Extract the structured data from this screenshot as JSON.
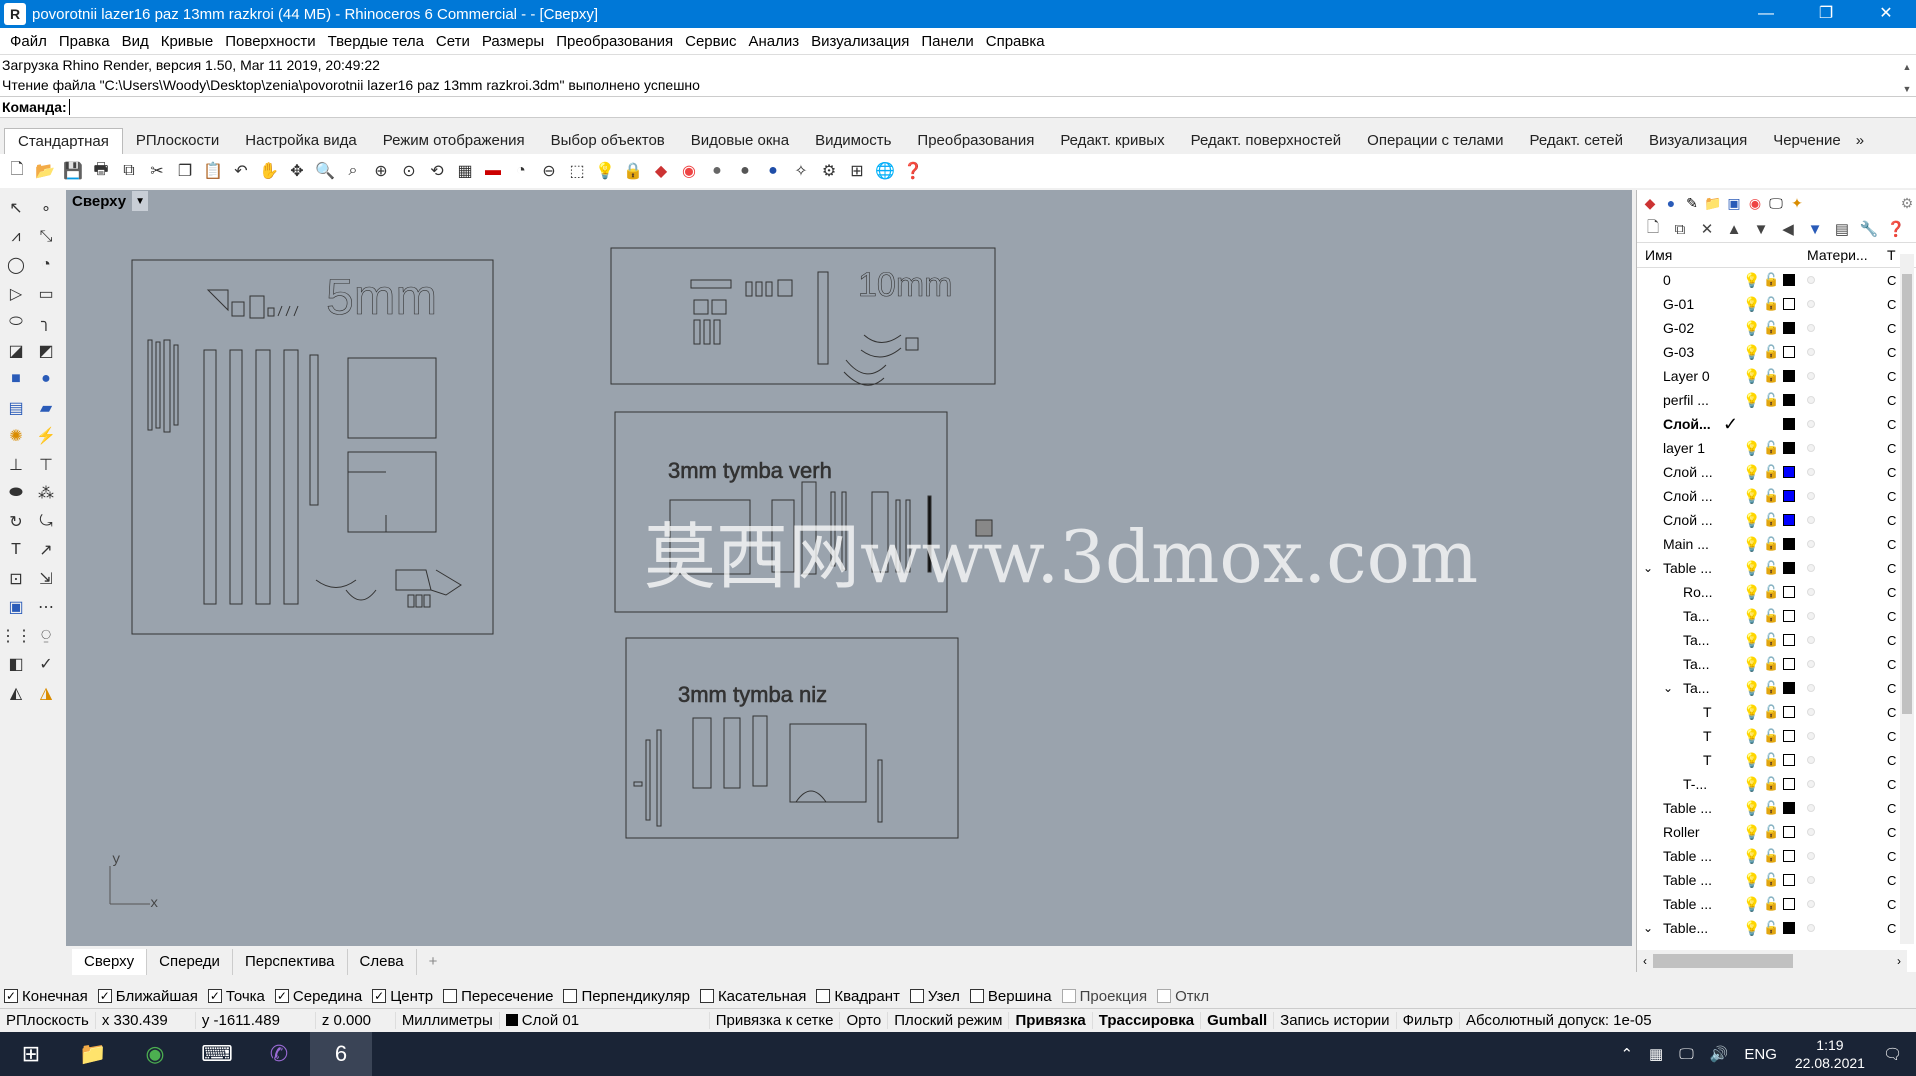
{
  "window": {
    "title": "povorotnii lazer16 paz 13mm razkroi (44 МБ) - Rhinoceros 6 Commercial - - [Сверху]",
    "minimize": "—",
    "maximize": "❐",
    "close": "✕"
  },
  "menu": [
    "Файл",
    "Правка",
    "Вид",
    "Кривые",
    "Поверхности",
    "Твердые тела",
    "Сети",
    "Размеры",
    "Преобразования",
    "Сервис",
    "Анализ",
    "Визуализация",
    "Панели",
    "Справка"
  ],
  "history": [
    "Загрузка Rhino Render, версия 1.50, Mar 11 2019, 20:49:22",
    "Чтение файла \"C:\\Users\\Woody\\Desktop\\zenia\\povorotnii lazer16 paz 13mm razkroi.3dm\" выполнено успешно"
  ],
  "command": {
    "label": "Команда:",
    "value": ""
  },
  "toolbar_tabs": [
    "Стандартная",
    "РПлоскости",
    "Настройка вида",
    "Режим отображения",
    "Выбор объектов",
    "Видовые окна",
    "Видимость",
    "Преобразования",
    "Редакт. кривых",
    "Редакт. поверхностей",
    "Операции с телами",
    "Редакт. сетей",
    "Визуализация",
    "Черчение"
  ],
  "viewport": {
    "name": "Сверху",
    "axis_x": "x",
    "axis_y": "y",
    "panels": [
      {
        "label": "5mm"
      },
      {
        "label": "10mm"
      },
      {
        "label": "3mm tymba verh"
      },
      {
        "label": "3mm tymba niz"
      }
    ],
    "watermark": "莫西网www.3dmox.com"
  },
  "viewport_tabs": [
    "Сверху",
    "Спереди",
    "Перспектива",
    "Слева"
  ],
  "layers": {
    "col_name": "Имя",
    "col_material": "Матери...",
    "col_t": "Т",
    "rows": [
      {
        "name": "0",
        "indent": 0,
        "color": "#000000",
        "current": false,
        "expander": ""
      },
      {
        "name": "G-01",
        "indent": 0,
        "color": "#ffffff",
        "current": false,
        "expander": ""
      },
      {
        "name": "G-02",
        "indent": 0,
        "color": "#000000",
        "current": false,
        "expander": ""
      },
      {
        "name": "G-03",
        "indent": 0,
        "color": "#ffffff",
        "current": false,
        "expander": ""
      },
      {
        "name": "Layer 0",
        "indent": 0,
        "color": "#000000",
        "current": false,
        "expander": ""
      },
      {
        "name": "perfil ...",
        "indent": 0,
        "color": "#000000",
        "current": false,
        "expander": ""
      },
      {
        "name": "Слой...",
        "indent": 0,
        "color": "#000000",
        "current": true,
        "expander": ""
      },
      {
        "name": "layer 1",
        "indent": 0,
        "color": "#000000",
        "current": false,
        "expander": ""
      },
      {
        "name": "Слой ...",
        "indent": 0,
        "color": "#0000ff",
        "current": false,
        "expander": ""
      },
      {
        "name": "Слой ...",
        "indent": 0,
        "color": "#0000ff",
        "current": false,
        "expander": ""
      },
      {
        "name": "Слой ...",
        "indent": 0,
        "color": "#0000ff",
        "current": false,
        "expander": ""
      },
      {
        "name": "Main ...",
        "indent": 0,
        "color": "#000000",
        "current": false,
        "expander": ""
      },
      {
        "name": "Table ...",
        "indent": 0,
        "color": "#000000",
        "current": false,
        "expander": "⌄"
      },
      {
        "name": "Ro...",
        "indent": 1,
        "color": "#ffffff",
        "current": false,
        "expander": ""
      },
      {
        "name": "Ta...",
        "indent": 1,
        "color": "#ffffff",
        "current": false,
        "expander": ""
      },
      {
        "name": "Ta...",
        "indent": 1,
        "color": "#ffffff",
        "current": false,
        "expander": ""
      },
      {
        "name": "Ta...",
        "indent": 1,
        "color": "#ffffff",
        "current": false,
        "expander": ""
      },
      {
        "name": "Ta...",
        "indent": 1,
        "color": "#000000",
        "current": false,
        "expander": "⌄"
      },
      {
        "name": "T",
        "indent": 2,
        "color": "#ffffff",
        "current": false,
        "expander": ""
      },
      {
        "name": "T",
        "indent": 2,
        "color": "#ffffff",
        "current": false,
        "expander": ""
      },
      {
        "name": "T",
        "indent": 2,
        "color": "#ffffff",
        "current": false,
        "expander": ""
      },
      {
        "name": "T-...",
        "indent": 1,
        "color": "#ffffff",
        "current": false,
        "expander": ""
      },
      {
        "name": "Table ...",
        "indent": 0,
        "color": "#000000",
        "current": false,
        "expander": ""
      },
      {
        "name": "Roller",
        "indent": 0,
        "color": "#ffffff",
        "current": false,
        "expander": ""
      },
      {
        "name": "Table ...",
        "indent": 0,
        "color": "#ffffff",
        "current": false,
        "expander": ""
      },
      {
        "name": "Table ...",
        "indent": 0,
        "color": "#ffffff",
        "current": false,
        "expander": ""
      },
      {
        "name": "Table ...",
        "indent": 0,
        "color": "#ffffff",
        "current": false,
        "expander": ""
      },
      {
        "name": "Table...",
        "indent": 0,
        "color": "#000000",
        "current": false,
        "expander": "⌄"
      }
    ],
    "t_value": "С"
  },
  "osnaps": [
    {
      "label": "Конечная",
      "checked": true,
      "enabled": true
    },
    {
      "label": "Ближайшая",
      "checked": true,
      "enabled": true
    },
    {
      "label": "Точка",
      "checked": true,
      "enabled": true
    },
    {
      "label": "Середина",
      "checked": true,
      "enabled": true
    },
    {
      "label": "Центр",
      "checked": true,
      "enabled": true
    },
    {
      "label": "Пересечение",
      "checked": false,
      "enabled": true
    },
    {
      "label": "Перпендикуляр",
      "checked": false,
      "enabled": true
    },
    {
      "label": "Касательная",
      "checked": false,
      "enabled": true
    },
    {
      "label": "Квадрант",
      "checked": false,
      "enabled": true
    },
    {
      "label": "Узел",
      "checked": false,
      "enabled": true
    },
    {
      "label": "Вершина",
      "checked": false,
      "enabled": true
    },
    {
      "label": "Проекция",
      "checked": false,
      "enabled": false
    },
    {
      "label": "Откл",
      "checked": false,
      "enabled": false
    }
  ],
  "status": {
    "cplane": "РПлоскость",
    "x": "x 330.439",
    "y": "y -1611.489",
    "z": "z 0.000",
    "units": "Миллиметры",
    "layer": "Слой 01",
    "grid_snap": "Привязка к сетке",
    "ortho": "Орто",
    "planar": "Плоский режим",
    "osnap": "Привязка",
    "smarttrack": "Трассировка",
    "gumball": "Gumball",
    "history": "Запись истории",
    "filter": "Фильтр",
    "tolerance": "Абсолютный допуск: 1e-05"
  },
  "taskbar": {
    "lang": "ENG",
    "time": "1:19",
    "date": "22.08.2021",
    "app_badge": "6"
  },
  "colors": {
    "accent": "#0078d7",
    "viewport_bg": "#9aa3ad",
    "taskbar": "#1a2436"
  }
}
